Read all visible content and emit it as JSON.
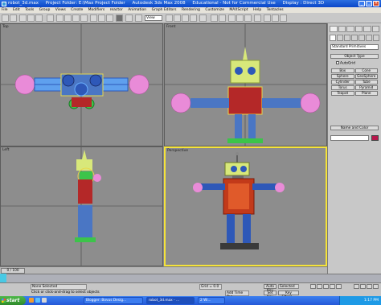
{
  "window": {
    "title_file": "robot_3d.max",
    "title_project": "Project Folder: E:\\Max Project Folder",
    "title_app": "Autodesk 3ds Max 2008",
    "title_license": "Educational - Not for Commercial Use",
    "title_display": "Display : Direct 3D"
  },
  "menu": [
    "File",
    "Edit",
    "Tools",
    "Group",
    "Views",
    "Create",
    "Modifiers",
    "reactor",
    "Animation",
    "Graph Editors",
    "Rendering",
    "Customize",
    "MAXScript",
    "Help",
    "Tentacles"
  ],
  "toolbar": {
    "view_combo": "View"
  },
  "viewports": {
    "top": "Top",
    "front": "Front",
    "left": "Left",
    "perspective": "Perspective"
  },
  "command_panel": {
    "category": "Standard Primitives",
    "object_type_title": "Object Type",
    "autogrid": "AutoGrid",
    "primitives": [
      "Box",
      "Cone",
      "Sphere",
      "GeoSphere",
      "Cylinder",
      "Tube",
      "Torus",
      "Pyramid",
      "Teapot",
      "Plane"
    ],
    "name_color_title": "Name and Color"
  },
  "timeline": {
    "frame": "0 / 100"
  },
  "status": {
    "selection": "None Selected",
    "prompt": "Click or click-and-drag to select objects",
    "grid": "Grid = 0.0",
    "add_time_tag": "Add Time Tag",
    "auto_key": "Auto Key",
    "selected": "Selected",
    "set_key": "Set Key",
    "key_filters": "Key Filters..."
  },
  "taskbar": {
    "start": "start",
    "tasks": [
      "Blogger: Bovus Desig...",
      "robot_3d.max - ...",
      "2 Wi..."
    ],
    "clock": "1:17 PM"
  },
  "colors": {
    "title_blue": "#0a46c8",
    "viewport_gray": "#8d8d8d",
    "active_viewport": "#f5e33a",
    "robot_head_yellow": "#d8e87a",
    "robot_body_red": "#b42828",
    "robot_limb_blue": "#2e58b8",
    "robot_hand_pink": "#e98bd8",
    "start_green": "#2e8b2b"
  }
}
